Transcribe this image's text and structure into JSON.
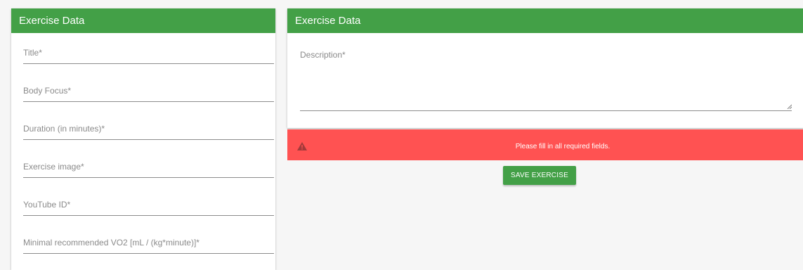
{
  "left_card": {
    "header": "Exercise Data",
    "fields": [
      {
        "label": "Title*"
      },
      {
        "label": "Body Focus*"
      },
      {
        "label": "Duration (in minutes)*"
      },
      {
        "label": "Exercise image*"
      },
      {
        "label": "YouTube ID*"
      },
      {
        "label": "Minimal recommended VO2 [mL / (kg*minute)]*"
      }
    ]
  },
  "right_card": {
    "header": "Exercise Data",
    "description_label": "Description*"
  },
  "alert": {
    "message": "Please fill in all required fields.",
    "icon": "warning-icon"
  },
  "save_button_label": "SAVE EXERCISE",
  "colors": {
    "header_green": "#43a047",
    "alert_red": "#ff5252",
    "background": "#f6f6f6"
  }
}
